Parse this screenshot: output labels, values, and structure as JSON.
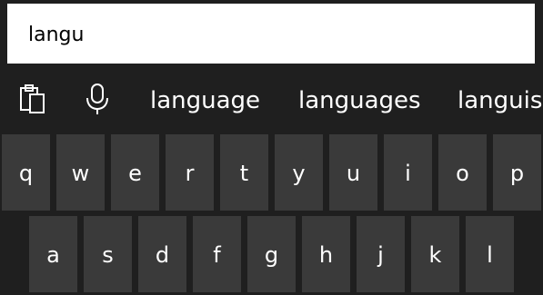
{
  "input": {
    "value": "langu"
  },
  "suggestion_bar": {
    "icons": {
      "clipboard": "clipboard-icon",
      "microphone": "microphone-icon"
    },
    "suggestions": [
      "language",
      "languages",
      "languis"
    ]
  },
  "keyboard": {
    "row1": [
      "q",
      "w",
      "e",
      "r",
      "t",
      "y",
      "u",
      "i",
      "o",
      "p"
    ],
    "row2": [
      "a",
      "s",
      "d",
      "f",
      "g",
      "h",
      "j",
      "k",
      "l"
    ]
  },
  "colors": {
    "background": "#1f1f1f",
    "key": "#3a3a3a",
    "input_background": "#ffffff",
    "text": "#ffffff"
  }
}
